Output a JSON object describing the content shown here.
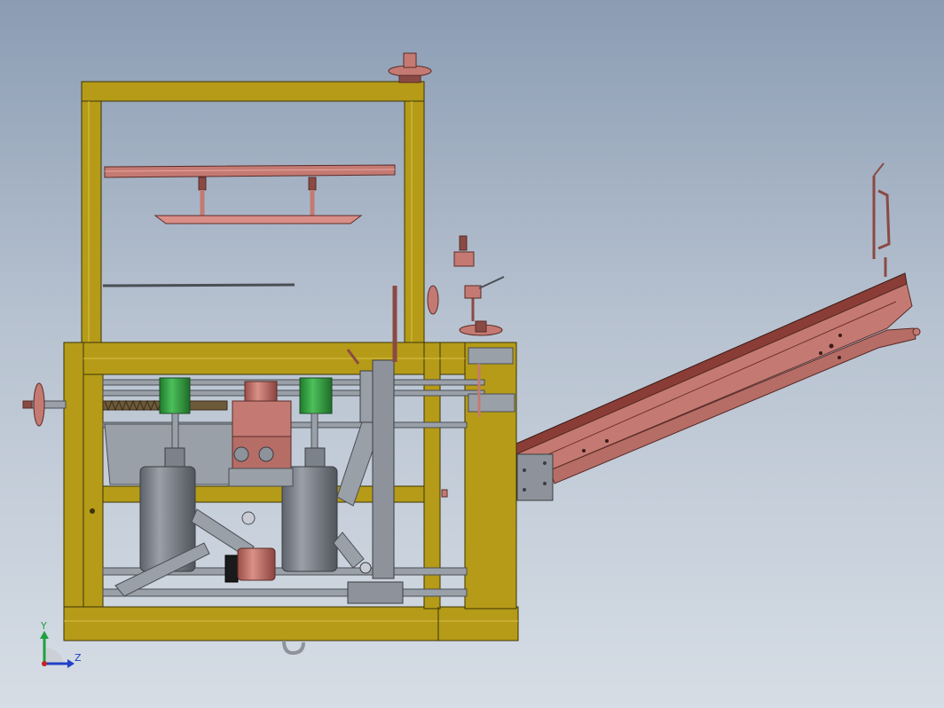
{
  "viewport": {
    "background_top": "#8b9cb3",
    "background_bottom": "#d6dde5"
  },
  "colors": {
    "frame_fill": "#b59b17",
    "frame_edge": "#3a3408",
    "part_red": "#c47a72",
    "part_red_dark": "#8a4a44",
    "part_gray": "#8e939b",
    "part_gray_dark": "#4a4e55",
    "motor_green": "#37a045",
    "axis_x": "#c82020",
    "axis_y": "#20a040",
    "axis_z": "#2040c8"
  },
  "triad": {
    "y_label": "Y",
    "z_label": "Z"
  }
}
